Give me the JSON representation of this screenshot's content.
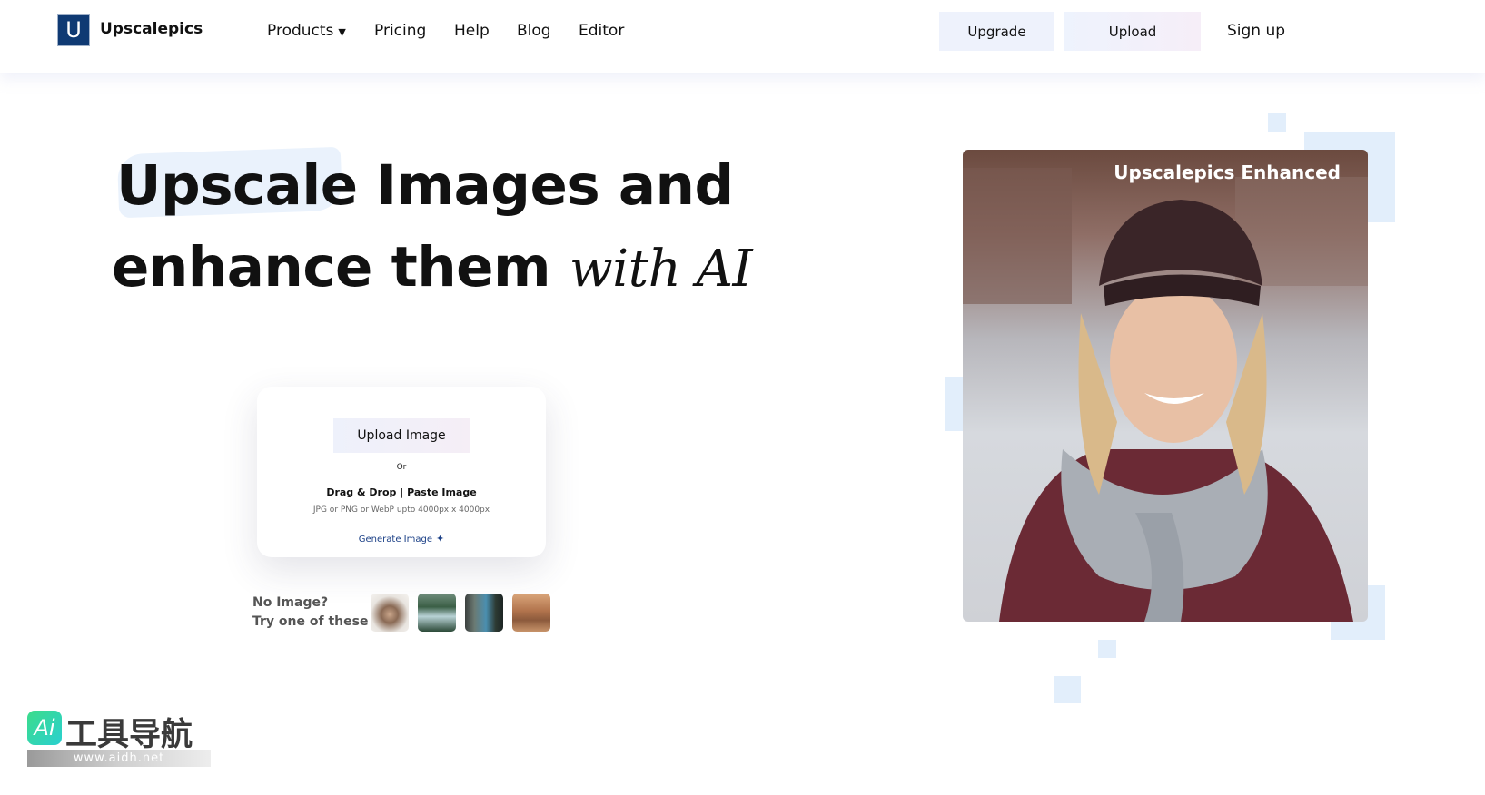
{
  "nav": {
    "logo_letter": "U",
    "brand": "Upscalepics",
    "links": {
      "products": "Products",
      "pricing": "Pricing",
      "help": "Help",
      "blog": "Blog",
      "editor": "Editor"
    },
    "upgrade": "Upgrade",
    "upload": "Upload",
    "signup": "Sign up"
  },
  "hero": {
    "line1_highlight": "Upscale",
    "line1_rest": "Images and",
    "line2_main": "enhance them",
    "line2_script": "with AI"
  },
  "upload_card": {
    "button": "Upload Image",
    "or": "Or",
    "drag": "Drag & Drop | Paste Image",
    "formats": "JPG or PNG or WebP upto 4000px x 4000px",
    "generate": "Generate Image",
    "generate_icon": "sparkle-icon"
  },
  "samples": {
    "line1": "No Image?",
    "line2": "Try one of these :"
  },
  "preview": {
    "label": "Upscalepics Enhanced"
  },
  "watermark": {
    "badge": "Ai",
    "title": "工具导航",
    "url": "www.aidh.net"
  },
  "colors": {
    "brand": "#0f3a73",
    "accent_link": "#1a3f86",
    "deco": "#e2eefb"
  }
}
